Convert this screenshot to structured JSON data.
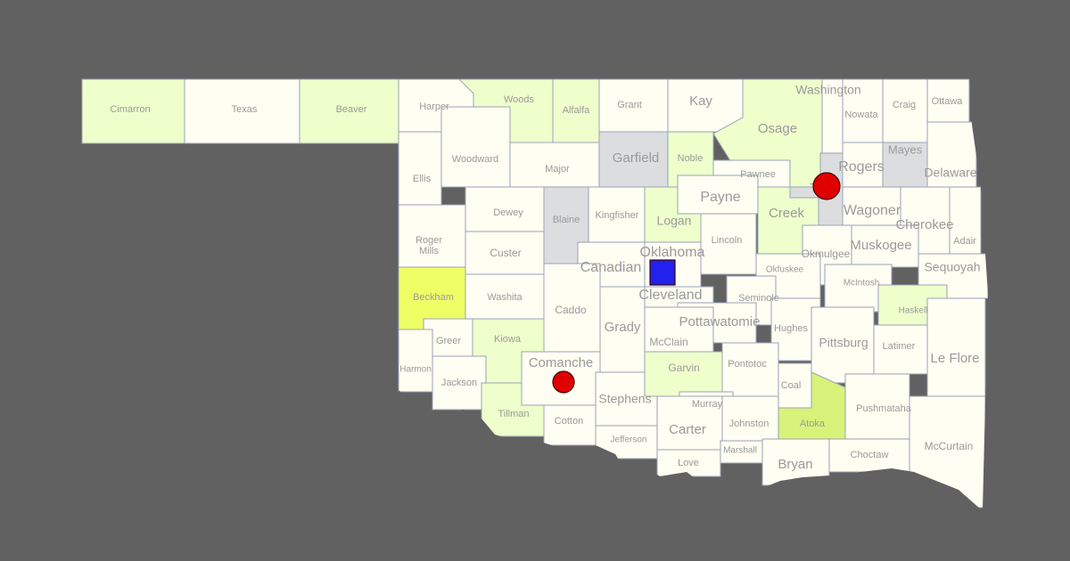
{
  "colors": {
    "background": "#616161",
    "base": "#fefef2",
    "light_green": "#eeffcc",
    "yellow": "#eeff66",
    "green": "#d9f27a",
    "gray": "#dcdddf",
    "border": "#9aa3b5",
    "label": "#9a9a9a"
  },
  "counties": [
    {
      "name": "Cimarron",
      "fill": "light_green"
    },
    {
      "name": "Texas",
      "fill": "base"
    },
    {
      "name": "Beaver",
      "fill": "light_green"
    },
    {
      "name": "Harper",
      "fill": "base"
    },
    {
      "name": "Woods",
      "fill": "light_green"
    },
    {
      "name": "Alfalfa",
      "fill": "light_green"
    },
    {
      "name": "Grant",
      "fill": "base"
    },
    {
      "name": "Kay",
      "fill": "base"
    },
    {
      "name": "Osage",
      "fill": "light_green"
    },
    {
      "name": "Washington",
      "fill": "base"
    },
    {
      "name": "Nowata",
      "fill": "base"
    },
    {
      "name": "Craig",
      "fill": "base"
    },
    {
      "name": "Ottawa",
      "fill": "base"
    },
    {
      "name": "Ellis",
      "fill": "base"
    },
    {
      "name": "Woodward",
      "fill": "base"
    },
    {
      "name": "Major",
      "fill": "base"
    },
    {
      "name": "Garfield",
      "fill": "gray"
    },
    {
      "name": "Noble",
      "fill": "light_green"
    },
    {
      "name": "Pawnee",
      "fill": "base"
    },
    {
      "name": "Rogers",
      "fill": "base"
    },
    {
      "name": "Mayes",
      "fill": "gray"
    },
    {
      "name": "Delaware",
      "fill": "base"
    },
    {
      "name": "Dewey",
      "fill": "base"
    },
    {
      "name": "Blaine",
      "fill": "gray"
    },
    {
      "name": "Kingfisher",
      "fill": "base"
    },
    {
      "name": "Logan",
      "fill": "light_green"
    },
    {
      "name": "Payne",
      "fill": "base"
    },
    {
      "name": "Creek",
      "fill": "light_green"
    },
    {
      "name": "Tulsa",
      "fill": "gray"
    },
    {
      "name": "Wagoner",
      "fill": "base"
    },
    {
      "name": "Cherokee",
      "fill": "base"
    },
    {
      "name": "Adair",
      "fill": "base"
    },
    {
      "name": "Roger Mills",
      "fill": "base"
    },
    {
      "name": "Custer",
      "fill": "base"
    },
    {
      "name": "Canadian",
      "fill": "base"
    },
    {
      "name": "Oklahoma",
      "fill": "base"
    },
    {
      "name": "Lincoln",
      "fill": "base"
    },
    {
      "name": "Okmulgee",
      "fill": "base"
    },
    {
      "name": "Muskogee",
      "fill": "base"
    },
    {
      "name": "Sequoyah",
      "fill": "base"
    },
    {
      "name": "Beckham",
      "fill": "yellow"
    },
    {
      "name": "Washita",
      "fill": "base"
    },
    {
      "name": "Caddo",
      "fill": "base"
    },
    {
      "name": "Cleveland",
      "fill": "base"
    },
    {
      "name": "Okfuskee",
      "fill": "base"
    },
    {
      "name": "McIntosh",
      "fill": "base"
    },
    {
      "name": "Seminole",
      "fill": "base"
    },
    {
      "name": "Pottawatomie",
      "fill": "base"
    },
    {
      "name": "Haskell",
      "fill": "light_green"
    },
    {
      "name": "Grady",
      "fill": "base"
    },
    {
      "name": "McClain",
      "fill": "base"
    },
    {
      "name": "Hughes",
      "fill": "base"
    },
    {
      "name": "Pittsburg",
      "fill": "base"
    },
    {
      "name": "Latimer",
      "fill": "base"
    },
    {
      "name": "Le Flore",
      "fill": "base"
    },
    {
      "name": "Greer",
      "fill": "base"
    },
    {
      "name": "Kiowa",
      "fill": "light_green"
    },
    {
      "name": "Harmon",
      "fill": "base"
    },
    {
      "name": "Jackson",
      "fill": "base"
    },
    {
      "name": "Tillman",
      "fill": "light_green"
    },
    {
      "name": "Comanche",
      "fill": "base"
    },
    {
      "name": "Cotton",
      "fill": "base"
    },
    {
      "name": "Stephens",
      "fill": "base"
    },
    {
      "name": "Garvin",
      "fill": "light_green"
    },
    {
      "name": "Pontotoc",
      "fill": "base"
    },
    {
      "name": "Murray",
      "fill": "base"
    },
    {
      "name": "Coal",
      "fill": "base"
    },
    {
      "name": "Atoka",
      "fill": "green"
    },
    {
      "name": "Pushmataha",
      "fill": "base"
    },
    {
      "name": "McCurtain",
      "fill": "base"
    },
    {
      "name": "Jefferson",
      "fill": "base"
    },
    {
      "name": "Carter",
      "fill": "base"
    },
    {
      "name": "Johnston",
      "fill": "base"
    },
    {
      "name": "Marshall",
      "fill": "base"
    },
    {
      "name": "Love",
      "fill": "base"
    },
    {
      "name": "Bryan",
      "fill": "base"
    },
    {
      "name": "Choctaw",
      "fill": "base"
    }
  ],
  "markers": [
    {
      "shape": "circle",
      "color": "#e00000",
      "near": "Tulsa"
    },
    {
      "shape": "circle",
      "color": "#e00000",
      "near": "Comanche"
    },
    {
      "shape": "square",
      "color": "#2222ee",
      "near": "Oklahoma"
    }
  ]
}
